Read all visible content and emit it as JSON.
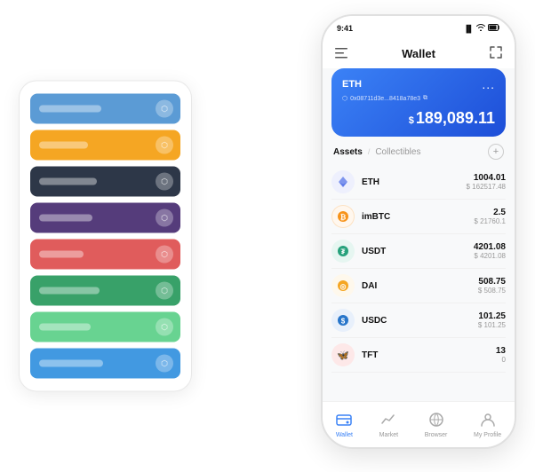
{
  "app": {
    "title": "Wallet"
  },
  "status_bar": {
    "time": "9:41",
    "signal": "▐▌▌",
    "wifi": "WiFi",
    "battery": "🔋"
  },
  "header": {
    "menu_icon": "☰",
    "title": "Wallet",
    "expand_icon": "⛶"
  },
  "eth_card": {
    "title": "ETH",
    "dots": "...",
    "address": "0x08711d3e...8418a78e3",
    "address_icon": "⬡",
    "balance_prefix": "$",
    "balance": "189,089.11"
  },
  "assets": {
    "tab_active": "Assets",
    "divider": "/",
    "tab_inactive": "Collectibles",
    "add_icon": "+"
  },
  "tokens": [
    {
      "symbol": "ETH",
      "icon_char": "◆",
      "icon_color": "#627eea",
      "icon_bg": "#eef0fd",
      "amount": "1004.01",
      "usd": "$ 162517.48"
    },
    {
      "symbol": "imBTC",
      "icon_char": "₿",
      "icon_color": "#f7931a",
      "icon_bg": "#fef3e2",
      "amount": "2.5",
      "usd": "$ 21760.1"
    },
    {
      "symbol": "USDT",
      "icon_char": "₮",
      "icon_color": "#26a17b",
      "icon_bg": "#e6f6f1",
      "amount": "4201.08",
      "usd": "$ 4201.08"
    },
    {
      "symbol": "DAI",
      "icon_char": "◎",
      "icon_color": "#f5a623",
      "icon_bg": "#fef8ec",
      "amount": "508.75",
      "usd": "$ 508.75"
    },
    {
      "symbol": "USDC",
      "icon_char": "$",
      "icon_color": "#2775ca",
      "icon_bg": "#e8f0fb",
      "amount": "101.25",
      "usd": "$ 101.25"
    },
    {
      "symbol": "TFT",
      "icon_char": "🦋",
      "icon_color": "#e53e3e",
      "icon_bg": "#fde8e8",
      "amount": "13",
      "usd": "0"
    }
  ],
  "nav": [
    {
      "label": "Wallet",
      "icon": "👛",
      "active": true
    },
    {
      "label": "Market",
      "icon": "📊",
      "active": false
    },
    {
      "label": "Browser",
      "icon": "🌐",
      "active": false
    },
    {
      "label": "My Profile",
      "icon": "👤",
      "active": false
    }
  ],
  "card_stack": [
    {
      "color": "#5b9bd5",
      "label_width": "70px"
    },
    {
      "color": "#f5a623",
      "label_width": "55px"
    },
    {
      "color": "#2d3748",
      "label_width": "65px"
    },
    {
      "color": "#553c7b",
      "label_width": "60px"
    },
    {
      "color": "#e05c5c",
      "label_width": "50px"
    },
    {
      "color": "#38a169",
      "label_width": "68px"
    },
    {
      "color": "#68d391",
      "label_width": "58px"
    },
    {
      "color": "#4299e1",
      "label_width": "72px"
    }
  ]
}
